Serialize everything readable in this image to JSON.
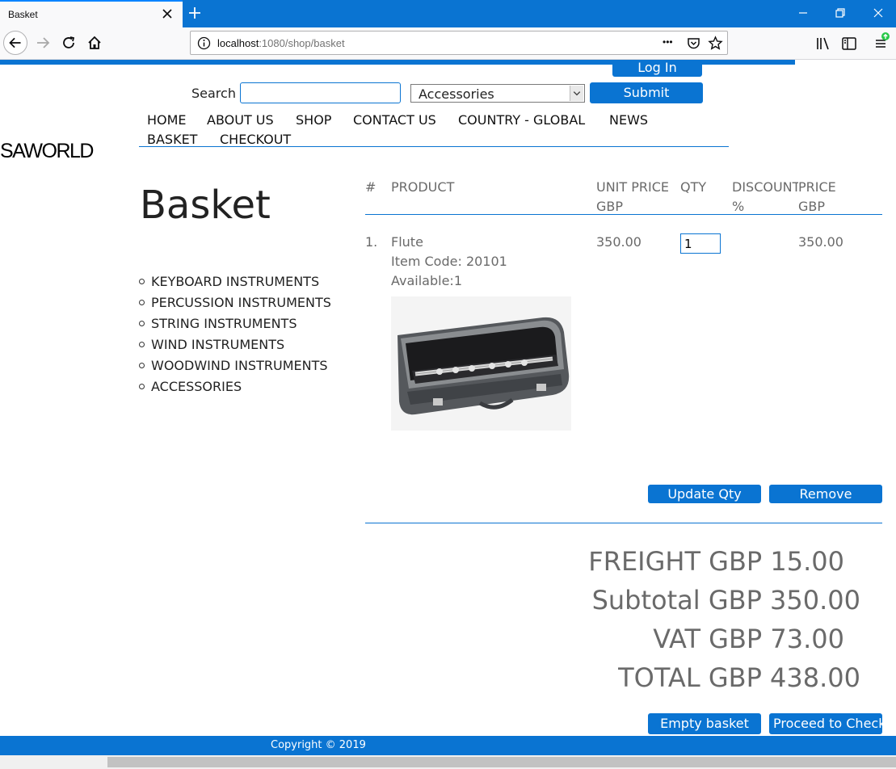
{
  "browser": {
    "tab_title": "Basket",
    "url_host": "localhost",
    "url_rest": ":1080/shop/basket",
    "url_more": "•••",
    "icons": [
      "close-icon",
      "plus-icon",
      "minimize-icon",
      "restore-icon",
      "back-arrow-icon",
      "forward-arrow-icon",
      "reload-icon",
      "home-icon",
      "info-icon",
      "pocket-icon",
      "star-icon",
      "library-icon",
      "sidebar-icon",
      "menu-icon"
    ]
  },
  "header": {
    "login_label": "Log In",
    "search_label": "Search",
    "search_value": "",
    "category_selected": "Accessories",
    "submit_label": "Submit"
  },
  "nav": {
    "items": [
      "HOME",
      "ABOUT US",
      "SHOP",
      "CONTACT US",
      "COUNTRY - GLOBAL",
      "NEWS",
      "BASKET",
      "CHECKOUT"
    ]
  },
  "logo_text": "SAWORLD",
  "page_title": "Basket",
  "categories": [
    "KEYBOARD INSTRUMENTS",
    "PERCUSSION INSTRUMENTS",
    "STRING INSTRUMENTS",
    "WIND INSTRUMENTS",
    "WOODWIND INSTRUMENTS",
    "ACCESSORIES"
  ],
  "table": {
    "headers": {
      "num": "#",
      "product": "PRODUCT",
      "unit_price_1": "UNIT PRICE",
      "unit_price_2": "GBP",
      "qty": "QTY",
      "discount_1": "DISCOUNT",
      "discount_2": "%",
      "price_1": "PRICE",
      "price_2": "GBP"
    },
    "rows": [
      {
        "num": "1.",
        "name": "Flute",
        "item_code": "Item Code: 20101",
        "available": "Available:1",
        "unit_price": "350.00",
        "qty": "1",
        "discount": "",
        "price": "350.00"
      }
    ]
  },
  "actions": {
    "update_label": "Update Qty",
    "remove_label": "Remove",
    "empty_label": "Empty basket",
    "checkout_label": "Proceed to Checkout"
  },
  "totals": {
    "freight": "FREIGHT GBP 15.00",
    "subtotal": "Subtotal GBP 350.00",
    "vat": "VAT GBP 73.00",
    "total": "TOTAL GBP 438.00"
  },
  "footer": {
    "copyright": "Copyright © 2019"
  },
  "colors": {
    "accent": "#0a74d2",
    "text_muted": "#6a6a6a"
  }
}
